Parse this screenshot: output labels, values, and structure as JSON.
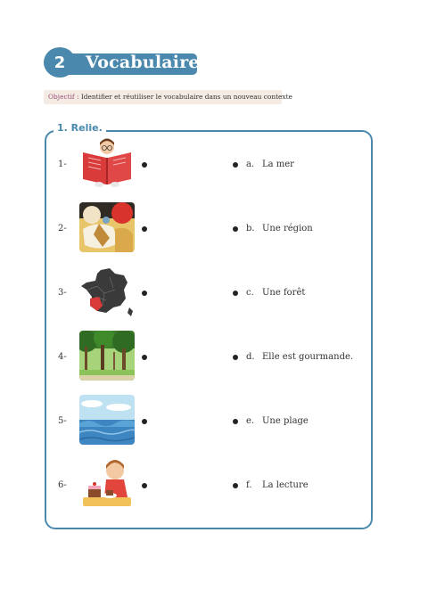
{
  "header": {
    "number": "2",
    "title": "Vocabulaire",
    "accent_color": "#4a89ad"
  },
  "objective": {
    "label": "Objectif :",
    "text": "Identifier et réutiliser le vocabulaire dans un nouveau contexte"
  },
  "exercise": {
    "title": "1. Relie.",
    "items": [
      {
        "number": "1-",
        "image": "child-reading-book-icon"
      },
      {
        "number": "2-",
        "image": "pastries-icon"
      },
      {
        "number": "3-",
        "image": "france-map-icon"
      },
      {
        "number": "4-",
        "image": "forest-icon"
      },
      {
        "number": "5-",
        "image": "sea-waves-icon"
      },
      {
        "number": "6-",
        "image": "child-eating-cake-icon"
      }
    ],
    "answers": [
      {
        "letter": "a.",
        "text": "La mer"
      },
      {
        "letter": "b.",
        "text": "Une région"
      },
      {
        "letter": "c.",
        "text": "Une forêt"
      },
      {
        "letter": "d.",
        "text": "Elle est gourmande."
      },
      {
        "letter": "e.",
        "text": "Une plage"
      },
      {
        "letter": "f.",
        "text": "La lecture"
      }
    ]
  }
}
